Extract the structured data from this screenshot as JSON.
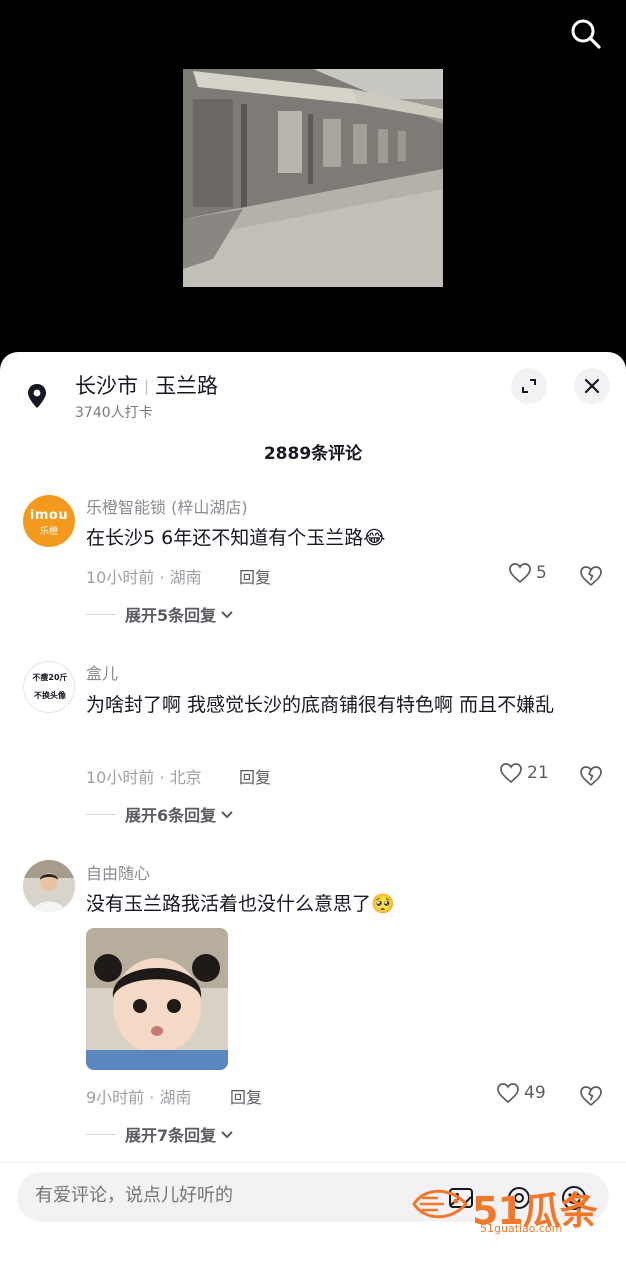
{
  "header": {
    "search_icon": "search-icon"
  },
  "location": {
    "city": "长沙市",
    "road": "玉兰路",
    "checkins": "3740人打卡",
    "pin_icon": "location-pin-icon",
    "expand_icon": "expand-icon",
    "close_icon": "close-icon"
  },
  "comments_count": "2889条评论",
  "comments": [
    {
      "user": "乐橙智能锁 (梓山湖店)",
      "avatar_text_top": "imou",
      "avatar_text_bottom": "乐橙",
      "text": "在长沙5 6年还不知道有个玉兰路",
      "emoji": "😂",
      "time_loc": "10小时前 · 湖南",
      "reply": "回复",
      "likes": "5",
      "expand": "展开5条回复"
    },
    {
      "user": "盒儿",
      "avatar_text_top": "不瘦20斤",
      "avatar_text_bottom": "不换头像",
      "text": "为啥封了啊  我感觉长沙的底商铺很有特色啊  而且不嫌乱",
      "time_loc": "10小时前 · 北京",
      "reply": "回复",
      "likes": "21",
      "expand": "展开6条回复"
    },
    {
      "user": "自由随心",
      "text": "没有玉兰路我活着也没什么意思了",
      "emoji": "🥺",
      "time_loc": "9小时前 · 湖南",
      "reply": "回复",
      "likes": "49",
      "expand": "展开7条回复"
    }
  ],
  "input": {
    "placeholder": "有爱评论，说点儿好听的"
  },
  "watermark": {
    "big": "51瓜条",
    "small": "51guatiao.com"
  },
  "colors": {
    "accent_orange": "#f1772a",
    "imou_orange": "#f39a1e",
    "text_dark": "#161823",
    "text_grey": "#8a8b91"
  }
}
